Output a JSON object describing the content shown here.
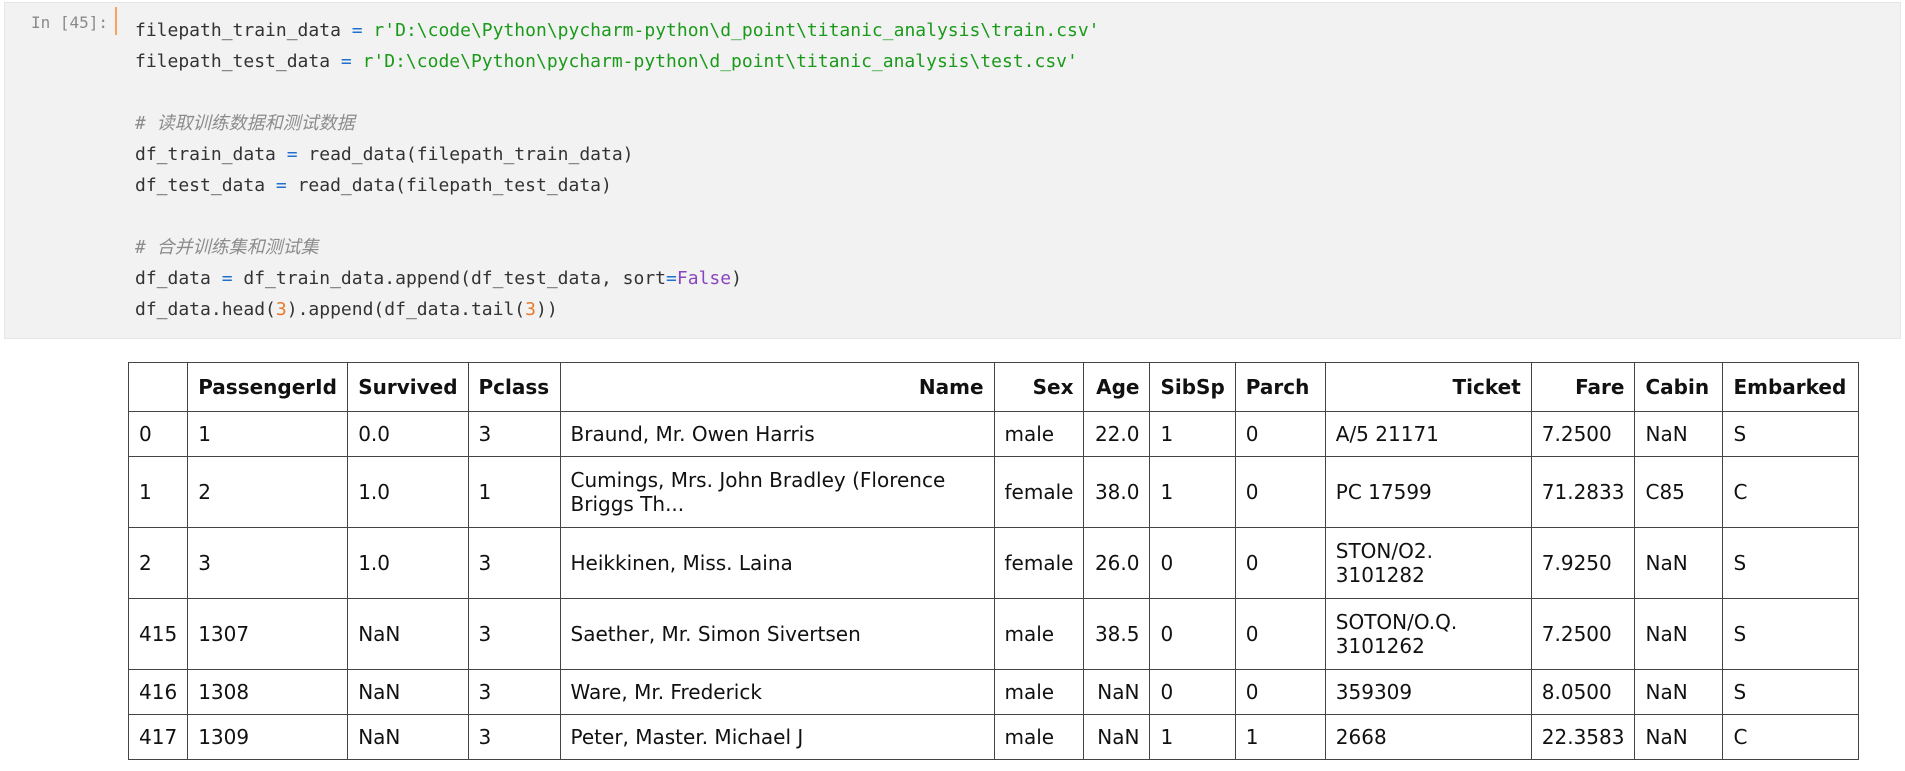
{
  "cell": {
    "prompt": "In [45]:",
    "code_lines": [
      [
        {
          "t": "filepath_train_data "
        },
        {
          "t": "=",
          "c": "op"
        },
        {
          "t": " r'D:\\code\\Python\\pycharm-python\\d_point\\titanic_analysis\\train.csv'",
          "c": "str"
        }
      ],
      [
        {
          "t": "filepath_test_data "
        },
        {
          "t": "=",
          "c": "op"
        },
        {
          "t": " r'D:\\code\\Python\\pycharm-python\\d_point\\titanic_analysis\\test.csv'",
          "c": "str"
        }
      ],
      [],
      [
        {
          "t": "# 读取训练数据和测试数据",
          "c": "cm"
        }
      ],
      [
        {
          "t": "df_train_data "
        },
        {
          "t": "=",
          "c": "op"
        },
        {
          "t": " read_data(filepath_train_data)"
        }
      ],
      [
        {
          "t": "df_test_data "
        },
        {
          "t": "=",
          "c": "op"
        },
        {
          "t": " read_data(filepath_test_data)"
        }
      ],
      [],
      [
        {
          "t": "# 合并训练集和测试集",
          "c": "cm"
        }
      ],
      [
        {
          "t": "df_data "
        },
        {
          "t": "=",
          "c": "op"
        },
        {
          "t": " df_train_data.append(df_test_data, sort"
        },
        {
          "t": "=",
          "c": "op"
        },
        {
          "t": "False",
          "c": "kw"
        },
        {
          "t": ")"
        }
      ],
      [
        {
          "t": "df_data.head("
        },
        {
          "t": "3",
          "c": "num"
        },
        {
          "t": ").append(df_data.tail("
        },
        {
          "t": "3",
          "c": "num"
        },
        {
          "t": "))"
        }
      ]
    ]
  },
  "output": {
    "columns": [
      "",
      "PassengerId",
      "Survived",
      "Pclass",
      "Name",
      "Sex",
      "Age",
      "SibSp",
      "Parch",
      "Ticket",
      "Fare",
      "Cabin",
      "Embarked"
    ],
    "rows": [
      [
        "0",
        "1",
        "0.0",
        "3",
        "Braund, Mr. Owen Harris",
        "male",
        "22.0",
        "1",
        "0",
        "A/5 21171",
        "7.2500",
        "NaN",
        "S"
      ],
      [
        "1",
        "2",
        "1.0",
        "1",
        "Cumings, Mrs. John Bradley (Florence Briggs Th...",
        "female",
        "38.0",
        "1",
        "0",
        "PC 17599",
        "71.2833",
        "C85",
        "C"
      ],
      [
        "2",
        "3",
        "1.0",
        "3",
        "Heikkinen, Miss. Laina",
        "female",
        "26.0",
        "0",
        "0",
        "STON/O2. 3101282",
        "7.9250",
        "NaN",
        "S"
      ],
      [
        "415",
        "1307",
        "NaN",
        "3",
        "Saether, Mr. Simon Sivertsen",
        "male",
        "38.5",
        "0",
        "0",
        "SOTON/O.Q. 3101262",
        "7.2500",
        "NaN",
        "S"
      ],
      [
        "416",
        "1308",
        "NaN",
        "3",
        "Ware, Mr. Frederick",
        "male",
        "NaN",
        "0",
        "0",
        "359309",
        "8.0500",
        "NaN",
        "S"
      ],
      [
        "417",
        "1309",
        "NaN",
        "3",
        "Peter, Master. Michael J",
        "male",
        "NaN",
        "1",
        "1",
        "2668",
        "22.3583",
        "NaN",
        "C"
      ]
    ]
  }
}
